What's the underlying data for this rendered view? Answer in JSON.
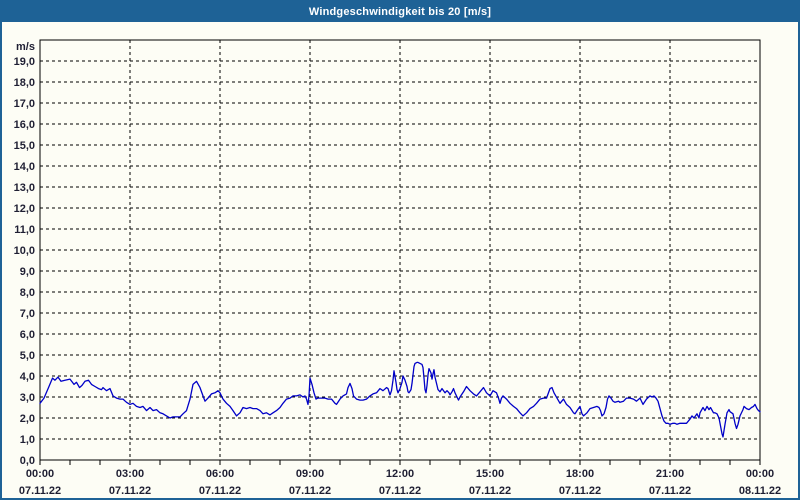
{
  "window": {
    "title": "Windgeschwindigkeit bis 20 [m/s]"
  },
  "colors": {
    "titlebar_bg": "#1e6296",
    "window_border": "#1e6296",
    "background": "#fdfdf5",
    "grid": "#000000",
    "axis": "#000000",
    "text": "#1f1f33",
    "title_text": "#ffffff",
    "line": "#0000c8"
  },
  "chart_data": {
    "type": "line",
    "title": "Windgeschwindigkeit bis 20 [m/s]",
    "xlabel": "",
    "ylabel": "m/s",
    "grid": "dashed",
    "legend": "none",
    "y_axis": {
      "unit": "m/s",
      "min": 0,
      "max": 20,
      "tick_step": 1.0,
      "tick_labels": [
        "0,0",
        "1,0",
        "2,0",
        "3,0",
        "4,0",
        "5,0",
        "6,0",
        "7,0",
        "8,0",
        "9,0",
        "10,0",
        "11,0",
        "12,0",
        "13,0",
        "14,0",
        "15,0",
        "16,0",
        "17,0",
        "18,0",
        "19,0"
      ]
    },
    "x_axis": {
      "start": "07.11.22 00:00",
      "end": "08.11.22 00:00",
      "minor_tick_hours": 1,
      "major_tick_hours": 3,
      "ticks": [
        {
          "hour": 0,
          "time": "00:00",
          "date": "07.11.22"
        },
        {
          "hour": 3,
          "time": "03:00",
          "date": "07.11.22"
        },
        {
          "hour": 6,
          "time": "06:00",
          "date": "07.11.22"
        },
        {
          "hour": 9,
          "time": "09:00",
          "date": "07.11.22"
        },
        {
          "hour": 12,
          "time": "12:00",
          "date": "07.11.22"
        },
        {
          "hour": 15,
          "time": "15:00",
          "date": "07.11.22"
        },
        {
          "hour": 18,
          "time": "18:00",
          "date": "07.11.22"
        },
        {
          "hour": 21,
          "time": "21:00",
          "date": "07.11.22"
        },
        {
          "hour": 24,
          "time": "00:00",
          "date": "08.11.22"
        }
      ]
    },
    "series": [
      {
        "name": "Windgeschwindigkeit",
        "unit": "m/s",
        "color": "#0000c8",
        "points_format": [
          "minutes_since_00:00",
          "m/s"
        ],
        "points": [
          [
            0,
            2.7
          ],
          [
            8,
            2.95
          ],
          [
            17,
            3.45
          ],
          [
            25,
            3.9
          ],
          [
            30,
            3.8
          ],
          [
            36,
            3.95
          ],
          [
            42,
            3.75
          ],
          [
            50,
            3.8
          ],
          [
            60,
            3.85
          ],
          [
            68,
            3.6
          ],
          [
            73,
            3.7
          ],
          [
            79,
            3.45
          ],
          [
            84,
            3.55
          ],
          [
            90,
            3.75
          ],
          [
            97,
            3.8
          ],
          [
            103,
            3.6
          ],
          [
            110,
            3.5
          ],
          [
            117,
            3.4
          ],
          [
            123,
            3.35
          ],
          [
            126,
            3.45
          ],
          [
            133,
            3.3
          ],
          [
            140,
            3.4
          ],
          [
            146,
            3.05
          ],
          [
            153,
            2.95
          ],
          [
            160,
            2.9
          ],
          [
            166,
            2.9
          ],
          [
            173,
            2.75
          ],
          [
            180,
            2.65
          ],
          [
            186,
            2.7
          ],
          [
            193,
            2.55
          ],
          [
            200,
            2.5
          ],
          [
            206,
            2.55
          ],
          [
            213,
            2.35
          ],
          [
            220,
            2.5
          ],
          [
            226,
            2.35
          ],
          [
            233,
            2.4
          ],
          [
            240,
            2.25
          ],
          [
            246,
            2.2
          ],
          [
            253,
            2.1
          ],
          [
            260,
            2.0
          ],
          [
            266,
            2.05
          ],
          [
            273,
            2.05
          ],
          [
            280,
            2.05
          ],
          [
            286,
            2.2
          ],
          [
            293,
            2.35
          ],
          [
            300,
            2.9
          ],
          [
            306,
            3.6
          ],
          [
            313,
            3.75
          ],
          [
            320,
            3.45
          ],
          [
            326,
            3.05
          ],
          [
            330,
            2.8
          ],
          [
            336,
            2.95
          ],
          [
            343,
            3.15
          ],
          [
            350,
            3.2
          ],
          [
            356,
            3.3
          ],
          [
            360,
            3.2
          ],
          [
            366,
            2.9
          ],
          [
            373,
            2.7
          ],
          [
            380,
            2.55
          ],
          [
            386,
            2.35
          ],
          [
            393,
            2.1
          ],
          [
            400,
            2.25
          ],
          [
            406,
            2.5
          ],
          [
            413,
            2.45
          ],
          [
            420,
            2.5
          ],
          [
            426,
            2.45
          ],
          [
            433,
            2.45
          ],
          [
            440,
            2.35
          ],
          [
            446,
            2.2
          ],
          [
            453,
            2.25
          ],
          [
            460,
            2.15
          ],
          [
            466,
            2.25
          ],
          [
            473,
            2.35
          ],
          [
            480,
            2.5
          ],
          [
            486,
            2.7
          ],
          [
            493,
            2.9
          ],
          [
            500,
            2.95
          ],
          [
            506,
            3.05
          ],
          [
            513,
            3.05
          ],
          [
            520,
            3.1
          ],
          [
            526,
            3.0
          ],
          [
            530,
            3.05
          ],
          [
            533,
            2.9
          ],
          [
            536,
            2.65
          ],
          [
            538,
            3.05
          ],
          [
            540,
            3.9
          ],
          [
            544,
            3.6
          ],
          [
            548,
            3.2
          ],
          [
            552,
            2.9
          ],
          [
            556,
            2.95
          ],
          [
            563,
            2.95
          ],
          [
            570,
            2.95
          ],
          [
            576,
            2.9
          ],
          [
            583,
            2.9
          ],
          [
            590,
            2.7
          ],
          [
            593,
            2.65
          ],
          [
            600,
            2.9
          ],
          [
            606,
            3.05
          ],
          [
            613,
            3.15
          ],
          [
            616,
            3.45
          ],
          [
            620,
            3.65
          ],
          [
            624,
            3.4
          ],
          [
            627,
            3.05
          ],
          [
            633,
            2.9
          ],
          [
            640,
            2.85
          ],
          [
            646,
            2.85
          ],
          [
            653,
            2.9
          ],
          [
            660,
            3.05
          ],
          [
            666,
            3.15
          ],
          [
            673,
            3.2
          ],
          [
            680,
            3.4
          ],
          [
            686,
            3.3
          ],
          [
            693,
            3.45
          ],
          [
            696,
            3.4
          ],
          [
            700,
            3.1
          ],
          [
            703,
            3.3
          ],
          [
            706,
            3.8
          ],
          [
            708,
            4.25
          ],
          [
            712,
            3.7
          ],
          [
            714,
            3.35
          ],
          [
            716,
            3.2
          ],
          [
            718,
            3.3
          ],
          [
            720,
            3.4
          ],
          [
            724,
            3.7
          ],
          [
            726,
            4.0
          ],
          [
            730,
            3.8
          ],
          [
            734,
            3.5
          ],
          [
            736,
            3.25
          ],
          [
            738,
            3.2
          ],
          [
            742,
            3.35
          ],
          [
            744,
            3.65
          ],
          [
            746,
            4.05
          ],
          [
            748,
            4.45
          ],
          [
            750,
            4.6
          ],
          [
            754,
            4.65
          ],
          [
            756,
            4.65
          ],
          [
            760,
            4.6
          ],
          [
            764,
            4.55
          ],
          [
            766,
            4.4
          ],
          [
            768,
            3.9
          ],
          [
            770,
            3.35
          ],
          [
            772,
            3.2
          ],
          [
            774,
            3.55
          ],
          [
            776,
            4.05
          ],
          [
            778,
            4.35
          ],
          [
            782,
            4.15
          ],
          [
            784,
            3.85
          ],
          [
            786,
            4.1
          ],
          [
            788,
            4.3
          ],
          [
            790,
            3.95
          ],
          [
            794,
            3.55
          ],
          [
            796,
            3.35
          ],
          [
            800,
            3.25
          ],
          [
            804,
            3.4
          ],
          [
            810,
            3.2
          ],
          [
            814,
            3.3
          ],
          [
            818,
            3.2
          ],
          [
            820,
            3.1
          ],
          [
            824,
            3.25
          ],
          [
            827,
            3.4
          ],
          [
            830,
            3.2
          ],
          [
            834,
            3.0
          ],
          [
            837,
            2.85
          ],
          [
            840,
            3.0
          ],
          [
            847,
            3.25
          ],
          [
            853,
            3.5
          ],
          [
            860,
            3.3
          ],
          [
            867,
            3.15
          ],
          [
            873,
            3.05
          ],
          [
            880,
            3.25
          ],
          [
            887,
            3.45
          ],
          [
            893,
            3.2
          ],
          [
            900,
            3.05
          ],
          [
            906,
            3.3
          ],
          [
            913,
            3.2
          ],
          [
            917,
            2.95
          ],
          [
            920,
            2.7
          ],
          [
            923,
            2.95
          ],
          [
            926,
            3.05
          ],
          [
            933,
            2.9
          ],
          [
            940,
            2.7
          ],
          [
            947,
            2.55
          ],
          [
            953,
            2.45
          ],
          [
            960,
            2.25
          ],
          [
            966,
            2.1
          ],
          [
            973,
            2.25
          ],
          [
            980,
            2.45
          ],
          [
            987,
            2.55
          ],
          [
            993,
            2.7
          ],
          [
            1000,
            2.9
          ],
          [
            1007,
            2.95
          ],
          [
            1013,
            2.95
          ],
          [
            1020,
            3.4
          ],
          [
            1024,
            3.45
          ],
          [
            1028,
            3.2
          ],
          [
            1034,
            2.95
          ],
          [
            1040,
            2.7
          ],
          [
            1047,
            2.9
          ],
          [
            1053,
            2.65
          ],
          [
            1060,
            2.5
          ],
          [
            1067,
            2.25
          ],
          [
            1070,
            2.2
          ],
          [
            1074,
            2.35
          ],
          [
            1080,
            2.55
          ],
          [
            1084,
            2.2
          ],
          [
            1087,
            2.1
          ],
          [
            1094,
            2.25
          ],
          [
            1100,
            2.45
          ],
          [
            1107,
            2.5
          ],
          [
            1114,
            2.55
          ],
          [
            1118,
            2.5
          ],
          [
            1121,
            2.35
          ],
          [
            1124,
            2.1
          ],
          [
            1128,
            2.2
          ],
          [
            1132,
            2.5
          ],
          [
            1135,
            2.9
          ],
          [
            1138,
            3.05
          ],
          [
            1142,
            2.95
          ],
          [
            1146,
            2.8
          ],
          [
            1150,
            2.75
          ],
          [
            1157,
            2.8
          ],
          [
            1160,
            2.75
          ],
          [
            1167,
            2.8
          ],
          [
            1173,
            2.95
          ],
          [
            1180,
            2.95
          ],
          [
            1187,
            2.9
          ],
          [
            1193,
            2.8
          ],
          [
            1200,
            2.95
          ],
          [
            1206,
            2.65
          ],
          [
            1213,
            2.9
          ],
          [
            1220,
            3.05
          ],
          [
            1224,
            3.0
          ],
          [
            1228,
            3.05
          ],
          [
            1232,
            2.95
          ],
          [
            1236,
            2.8
          ],
          [
            1240,
            2.45
          ],
          [
            1244,
            2.1
          ],
          [
            1248,
            1.85
          ],
          [
            1252,
            1.75
          ],
          [
            1256,
            1.75
          ],
          [
            1260,
            1.7
          ],
          [
            1266,
            1.75
          ],
          [
            1270,
            1.75
          ],
          [
            1274,
            1.7
          ],
          [
            1280,
            1.75
          ],
          [
            1287,
            1.75
          ],
          [
            1293,
            1.75
          ],
          [
            1300,
            1.95
          ],
          [
            1304,
            2.1
          ],
          [
            1308,
            2.0
          ],
          [
            1314,
            2.2
          ],
          [
            1318,
            2.0
          ],
          [
            1320,
            2.25
          ],
          [
            1326,
            2.5
          ],
          [
            1330,
            2.35
          ],
          [
            1334,
            2.55
          ],
          [
            1338,
            2.4
          ],
          [
            1341,
            2.5
          ],
          [
            1347,
            2.25
          ],
          [
            1350,
            2.25
          ],
          [
            1354,
            2.2
          ],
          [
            1358,
            2.0
          ],
          [
            1364,
            1.25
          ],
          [
            1366,
            1.1
          ],
          [
            1370,
            1.7
          ],
          [
            1374,
            2.25
          ],
          [
            1378,
            2.4
          ],
          [
            1380,
            2.3
          ],
          [
            1386,
            2.2
          ],
          [
            1390,
            1.75
          ],
          [
            1393,
            1.5
          ],
          [
            1396,
            1.7
          ],
          [
            1400,
            2.1
          ],
          [
            1406,
            2.4
          ],
          [
            1408,
            2.55
          ],
          [
            1413,
            2.45
          ],
          [
            1418,
            2.4
          ],
          [
            1423,
            2.5
          ],
          [
            1427,
            2.55
          ],
          [
            1430,
            2.65
          ],
          [
            1434,
            2.45
          ],
          [
            1437,
            2.35
          ],
          [
            1440,
            2.3
          ]
        ]
      }
    ]
  }
}
